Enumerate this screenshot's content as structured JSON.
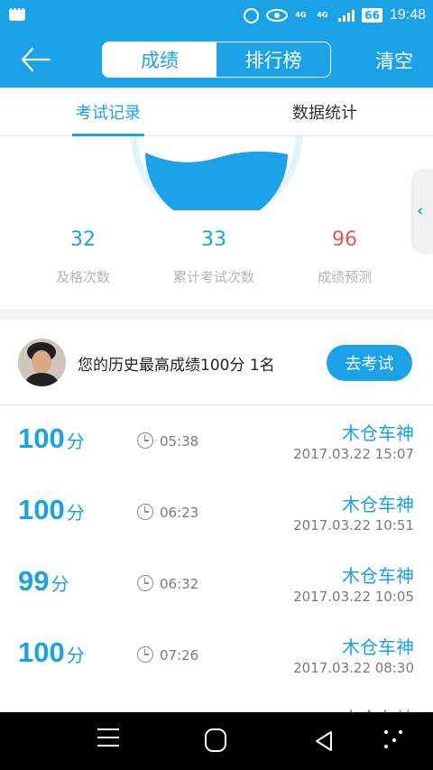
{
  "status_bar": {
    "network_a": "4G",
    "network_b": "4G",
    "battery": "66",
    "time": "19:48"
  },
  "header": {
    "segments": [
      "成绩",
      "排行榜"
    ],
    "active_segment": 0,
    "clear_label": "清空"
  },
  "tabs": [
    "考试记录",
    "数据统计"
  ],
  "stats": [
    {
      "value": "32",
      "label": "及格次数",
      "color": "#1aa1e6"
    },
    {
      "value": "33",
      "label": "累计考试次数",
      "color": "#1aa1e6"
    },
    {
      "value": "96",
      "label": "成绩预测",
      "color": "#e2595b"
    }
  ],
  "best": {
    "text": "您的历史最高成绩100分  1名",
    "button_label": "去考试"
  },
  "records": [
    {
      "score": "100",
      "unit": "分",
      "duration": "05:38",
      "name": "木仓车神",
      "date": "2017.03.22  15:07"
    },
    {
      "score": "100",
      "unit": "分",
      "duration": "06:23",
      "name": "木仓车神",
      "date": "2017.03.22  10:51"
    },
    {
      "score": "99",
      "unit": "分",
      "duration": "06:32",
      "name": "木仓车神",
      "date": "2017.03.22  10:05"
    },
    {
      "score": "100",
      "unit": "分",
      "duration": "07:26",
      "name": "木仓车神",
      "date": "2017.03.22  08:30"
    },
    {
      "score": "",
      "unit": "",
      "duration": "",
      "name": "木仓车神",
      "date": ""
    }
  ],
  "colors": {
    "accent": "#1aa1e6",
    "prediction": "#e2595b"
  }
}
